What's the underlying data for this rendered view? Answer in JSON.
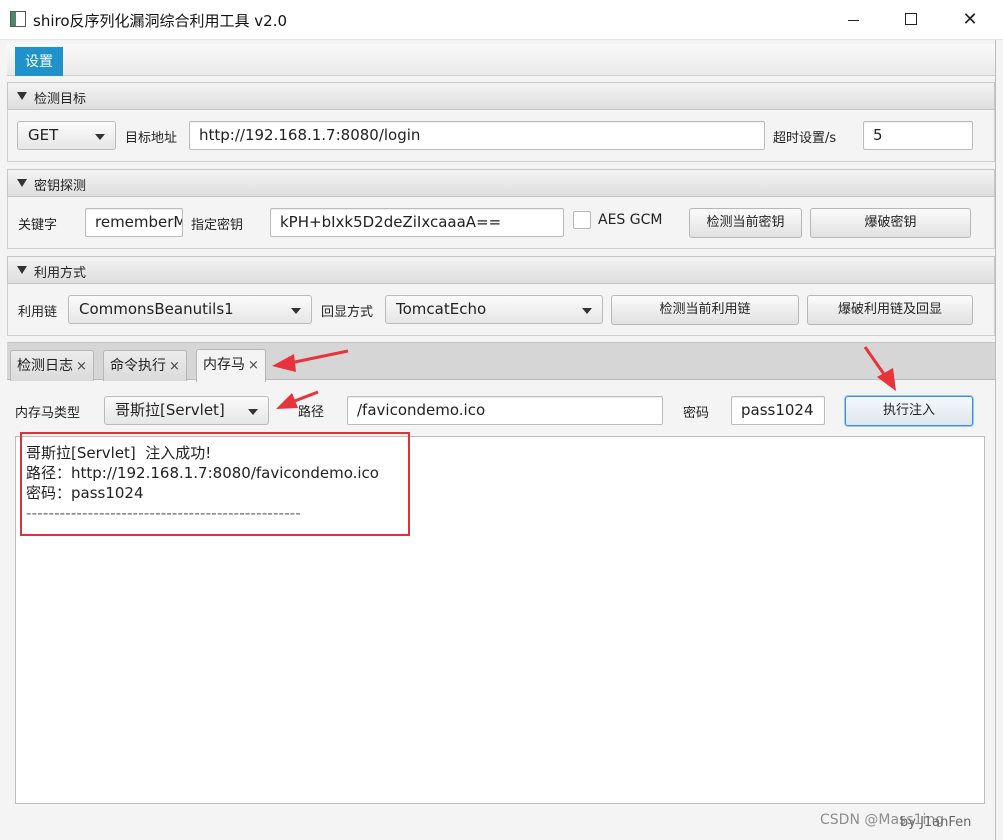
{
  "window": {
    "title": "shiro反序列化漏洞综合利用工具 v2.0",
    "min_glyph": "—",
    "max_glyph": "☐",
    "close_glyph": "✕"
  },
  "menu": {
    "settings_label": "设置"
  },
  "target_pane": {
    "title": "检测目标",
    "method": "GET",
    "url_label": "目标地址",
    "url_value": "http://192.168.1.7:8080/login",
    "timeout_label": "超时设置/s",
    "timeout_value": "5"
  },
  "key_pane": {
    "title": "密钥探测",
    "keyword_label": "关键字",
    "keyword_value": "rememberMe",
    "key_label": "指定密钥",
    "key_value": "kPH+bIxk5D2deZiIxcaaaA==",
    "aes_gcm_label": "AES GCM",
    "detect_key_button": "检测当前密钥",
    "brute_key_button": "爆破密钥"
  },
  "exploit_pane": {
    "title": "利用方式",
    "chain_label": "利用链",
    "chain_value": "CommonsBeanutils1",
    "echo_label": "回显方式",
    "echo_value": "TomcatEcho",
    "detect_chain_button": "检测当前利用链",
    "brute_chain_button": "爆破利用链及回显"
  },
  "tabs": [
    {
      "label": "检测日志",
      "close": "×"
    },
    {
      "label": "命令执行",
      "close": "×"
    },
    {
      "label": "内存马",
      "close": "×"
    }
  ],
  "memshell": {
    "type_label": "内存马类型",
    "type_value": "哥斯拉[Servlet]",
    "path_label": "路径",
    "path_value": "/favicondemo.ico",
    "password_label": "密码",
    "password_value": "pass1024",
    "inject_button": "执行注入"
  },
  "output": {
    "lines": [
      "哥斯拉[Servlet]  注入成功!",
      "路径：http://192.168.1.7:8080/favicondemo.ico",
      "密码：pass1024",
      "-------------------------------------------------"
    ]
  },
  "watermark": "CSDN @Mass1ing",
  "author": "by    J1anFen",
  "colors": {
    "accent": "#1f92cc",
    "annotation_red": "#e0303a"
  }
}
